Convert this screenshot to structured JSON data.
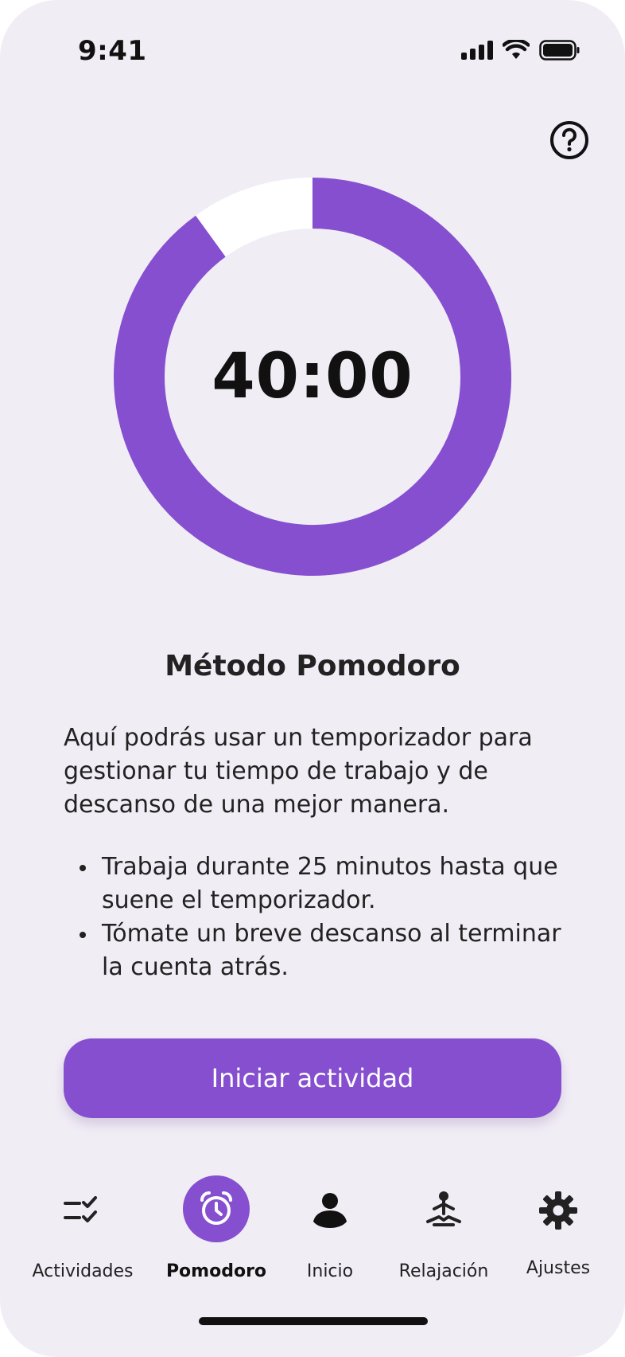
{
  "status_bar": {
    "time": "9:41",
    "icons": [
      "cellular-signal-icon",
      "wifi-icon",
      "battery-icon"
    ]
  },
  "header": {
    "help_icon": "question-circle-icon"
  },
  "timer": {
    "display": "40:00",
    "progress_fraction": 0.9,
    "progress_color": "#854FD0",
    "track_color": "#FFFFFF"
  },
  "content": {
    "title": "Método Pomodoro",
    "description": "Aquí podrás usar un temporizador para gestionar tu tiempo de trabajo y de descanso de una mejor manera.",
    "bullets": [
      "Trabaja durante 25 minutos hasta que suene el temporizador.",
      "Tómate un breve descanso al terminar la cuenta atrás."
    ]
  },
  "actions": {
    "start_label": "Iniciar actividad"
  },
  "nav": {
    "items": [
      {
        "label": "Actividades",
        "icon": "checklist-icon",
        "active": false
      },
      {
        "label": "Pomodoro",
        "icon": "alarm-clock-icon",
        "active": true
      },
      {
        "label": "Inicio",
        "icon": "person-icon",
        "active": false
      },
      {
        "label": "Relajación",
        "icon": "meditation-icon",
        "active": false
      },
      {
        "label": "Ajustes",
        "icon": "gear-icon",
        "active": false
      }
    ]
  },
  "colors": {
    "accent": "#854FD0",
    "background": "#F1EDF5",
    "text": "#222222"
  }
}
